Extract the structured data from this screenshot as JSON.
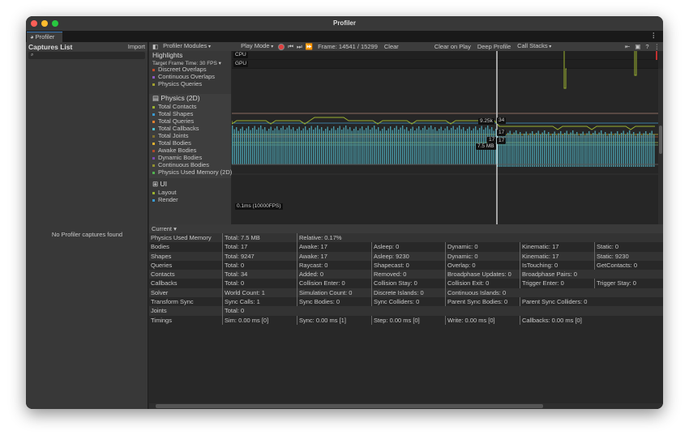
{
  "window": {
    "title": "Profiler",
    "tab": "Profiler"
  },
  "captures": {
    "title": "Captures List",
    "import": "Import",
    "empty": "No Profiler captures found"
  },
  "toolbar": {
    "modules": "Profiler Modules",
    "play_mode": "Play Mode",
    "frame": "Frame: 14541 / 15299",
    "clear": "Clear",
    "clear_on_play": "Clear on Play",
    "deep_profile": "Deep Profile",
    "call_stacks": "Call Stacks",
    "record_color": "#e04040"
  },
  "highlights": {
    "title": "Highlights",
    "target": "Target Frame Time: 30 FPS",
    "cpu": "CPU",
    "gpu": "GPU"
  },
  "physics3d_items": [
    {
      "label": "Discreet Overlaps",
      "color": "#c04a2a"
    },
    {
      "label": "Continuous Overlaps",
      "color": "#8a5ac0"
    },
    {
      "label": "Physics Queries",
      "color": "#a0a030"
    }
  ],
  "physics2d": {
    "title": "Physics (2D)",
    "items": [
      {
        "label": "Total Contacts",
        "color": "#9ab030"
      },
      {
        "label": "Total Shapes",
        "color": "#3a9ad0"
      },
      {
        "label": "Total Queries",
        "color": "#e08030"
      },
      {
        "label": "Total Callbacks",
        "color": "#50c0d0"
      },
      {
        "label": "Total Joints",
        "color": "#807030"
      },
      {
        "label": "Total Bodies",
        "color": "#e0b030"
      },
      {
        "label": "Awake Bodies",
        "color": "#b04a2a"
      },
      {
        "label": "Dynamic Bodies",
        "color": "#7a4ab0"
      },
      {
        "label": "Continuous Bodies",
        "color": "#909030"
      },
      {
        "label": "Physics Used Memory (2D)",
        "color": "#50b050"
      }
    ]
  },
  "chart_labels": {
    "shapes": "9.25k",
    "contacts": "34",
    "bodies": "17",
    "awake": "17",
    "dynamic": "17",
    "memory": "7.5 MB",
    "ui_scale": "0.1ms (10000FPS)"
  },
  "ui": {
    "title": "UI",
    "items": [
      {
        "label": "Layout",
        "color": "#9ab030"
      },
      {
        "label": "Render",
        "color": "#3a9ad0"
      }
    ]
  },
  "details": {
    "view": "Current",
    "rows": [
      [
        "Physics Used Memory",
        "Total: 7.5 MB",
        "Relative: 0.17%"
      ],
      [
        "Bodies",
        "Total: 17",
        "Awake: 17",
        "Asleep: 0",
        "Dynamic: 0",
        "Kinematic: 17",
        "Static: 0"
      ],
      [
        "Shapes",
        "Total: 9247",
        "Awake: 17",
        "Asleep: 9230",
        "Dynamic: 0",
        "Kinematic: 17",
        "Static: 9230"
      ],
      [
        "Queries",
        "Total: 0",
        "Raycast: 0",
        "Shapecast: 0",
        "Overlap: 0",
        "IsTouching: 0",
        "GetContacts: 0"
      ],
      [
        "Contacts",
        "Total: 34",
        "Added: 0",
        "Removed: 0",
        "Broadphase Updates: 0",
        "Broadphase Pairs: 0"
      ],
      [
        "Callbacks",
        "Total: 0",
        "Collision Enter: 0",
        "Collision Stay: 0",
        "Collision Exit: 0",
        "Trigger Enter: 0",
        "Trigger Stay: 0"
      ],
      [
        "Solver",
        "World Count: 1",
        "Simulation Count: 0",
        "Discrete Islands: 0",
        "Continuous Islands: 0"
      ],
      [
        "Transform Sync",
        "Sync Calls: 1",
        "Sync Bodies: 0",
        "Sync Colliders: 0",
        "Parent Sync Bodies: 0",
        "Parent Sync Colliders: 0"
      ],
      [
        "Joints",
        "Total: 0"
      ],
      [
        "Timings",
        "Sim: 0.00 ms [0]",
        "Sync: 0.00 ms [1]",
        "Step: 0.00 ms [0]",
        "Write: 0.00 ms [0]",
        "Callbacks: 0.00 ms [0]"
      ]
    ]
  }
}
